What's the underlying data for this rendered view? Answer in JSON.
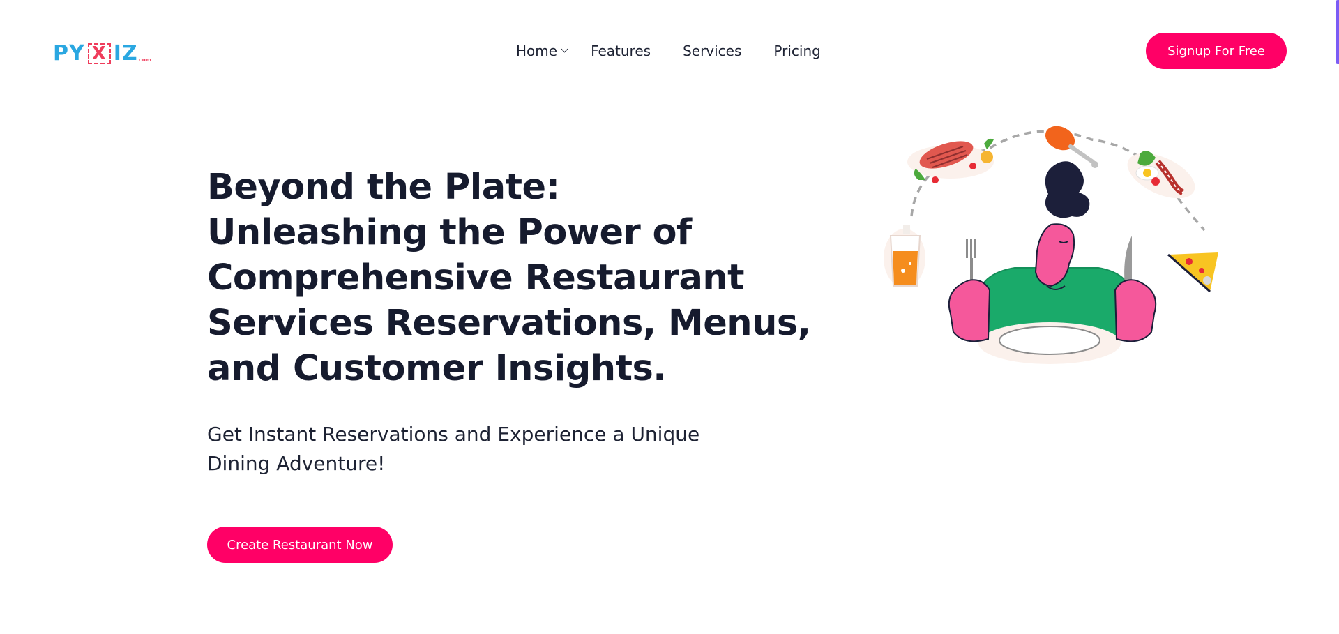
{
  "header": {
    "logo": {
      "left": "PY",
      "middle": "X",
      "right": "IZ",
      "tag": "com"
    },
    "nav": [
      {
        "label": "Home",
        "has_dropdown": true
      },
      {
        "label": "Features",
        "has_dropdown": false
      },
      {
        "label": "Services",
        "has_dropdown": false
      },
      {
        "label": "Pricing",
        "has_dropdown": false
      }
    ],
    "signup_label": "Signup For Free"
  },
  "hero": {
    "title_lines": [
      "Beyond the Plate:",
      "Unleashing the Power of",
      "Comprehensive Restaurant",
      "Services Reservations, Menus,",
      "and Customer Insights."
    ],
    "subtitle_lines": [
      "Get Instant Reservations and Experience a Unique",
      "Dining Adventure!"
    ],
    "cta_label": "Create Restaurant Now"
  },
  "illustration": {
    "subject": "person-with-plate-and-cutlery",
    "items": [
      "steak-icon",
      "chicken-leg-icon",
      "eggs-bacon-icon",
      "drink-glass-icon",
      "pizza-slice-icon"
    ]
  },
  "colors": {
    "accent": "#ff0066",
    "heading": "#161b2e",
    "logo_blue": "#2aa7e1",
    "logo_red": "#ef3d5c",
    "scroll_accent": "#7b5cf5"
  }
}
